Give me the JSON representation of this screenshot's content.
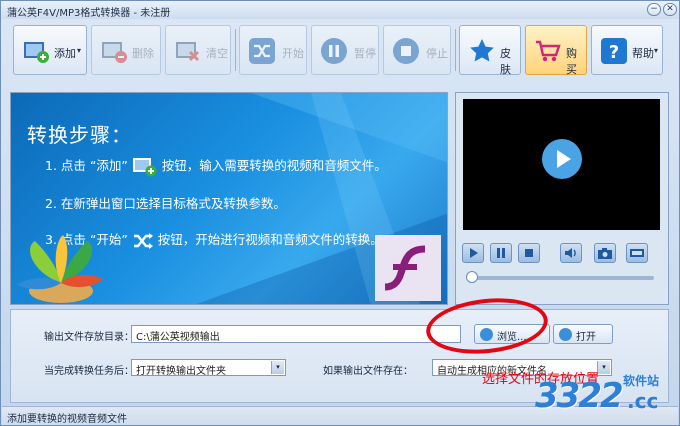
{
  "window": {
    "title": "蒲公英F4V/MP3格式转换器 - 未注册",
    "minimize_glyph": "−",
    "close_glyph": "✕"
  },
  "toolbar": {
    "add": "添加",
    "delete": "删除",
    "clear": "清空",
    "start": "开始",
    "pause": "暂停",
    "stop": "停止",
    "skin": "皮肤",
    "buy": "购买",
    "help": "帮助",
    "dropdown_glyph": "▾"
  },
  "guide": {
    "heading": "转换步骤：",
    "step1_a": "1. 点击 “添加”",
    "step1_b": "按钮，输入需要转换的视频和音频文件。",
    "step2": "2. 在新弹出窗口选择目标格式及转换参数。",
    "step3_a": "3. 点击 “开始”",
    "step3_b": "按钮，开始进行视频和音频文件的转换。"
  },
  "settings": {
    "output_dir_label": "输出文件存放目录：",
    "output_dir_value": "C:\\蒲公英视频输出",
    "browse_label": "浏览...",
    "open_label": "打开",
    "after_task_label": "当完成转换任务后：",
    "after_task_value": "打开转换输出文件夹",
    "if_exists_label": "如果输出文件存在：",
    "if_exists_value": "自动生成相应的新文件名"
  },
  "status": {
    "text": "添加要转换的视频音频文件"
  },
  "annotation": {
    "text": "选择文件的存放位置"
  },
  "watermark": {
    "number": "3322",
    "site": "软件站",
    "domain": ".cc"
  },
  "colors": {
    "accent": "#1a8fe0",
    "annotation": "#e30613",
    "buy": "#ffd37a"
  },
  "icons": [
    "add-file-icon",
    "delete-file-icon",
    "clear-icon",
    "shuffle-start-icon",
    "pause-icon",
    "stop-icon",
    "star-skin-icon",
    "cart-icon",
    "question-icon",
    "play-icon",
    "volume-icon",
    "camera-icon",
    "fullscreen-icon",
    "folder-browse-icon",
    "folder-open-icon"
  ]
}
